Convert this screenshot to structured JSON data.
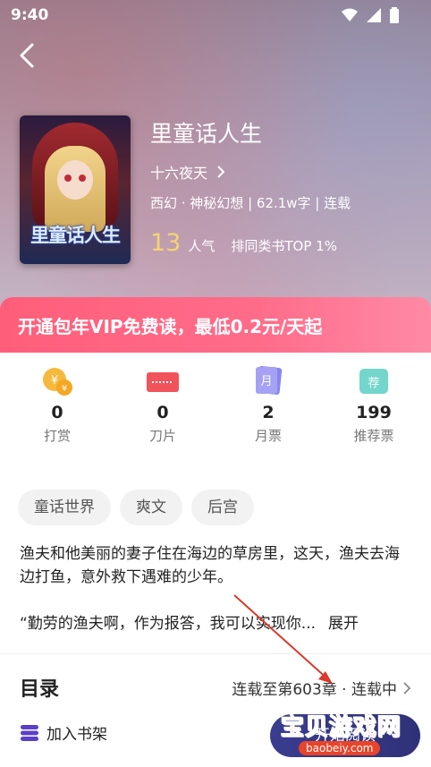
{
  "status": {
    "time": "9:40"
  },
  "book": {
    "cover_title": "里童话人生",
    "title": "里童话人生",
    "author": "十六夜天",
    "meta": "西幻 · 神秘幻想 | 62.1w字 | 连载",
    "popularity": "13",
    "popularity_label": "人气",
    "rank": "排同类书TOP 1%"
  },
  "vip": {
    "text": "开通包年VIP免费读，最低0.2元/天起"
  },
  "stats": [
    {
      "icon": "coin-icon",
      "value": "0",
      "label": "打赏"
    },
    {
      "icon": "blade-icon",
      "value": "0",
      "label": "刀片"
    },
    {
      "icon": "monthly-ticket-icon",
      "icon_text": "月",
      "value": "2",
      "label": "月票"
    },
    {
      "icon": "recommend-ticket-icon",
      "icon_text": "荐",
      "value": "199",
      "label": "推荐票"
    }
  ],
  "tags": [
    "童话世界",
    "爽文",
    "后宫"
  ],
  "description": {
    "para1": "渔夫和他美丽的妻子住在海边的草房里，这天，渔夫去海边打鱼，意外救下遇难的少年。",
    "para2": "“勤劳的渔夫啊，作为报答，我可以实现你...",
    "expand": "展开"
  },
  "toc": {
    "title": "目录",
    "status": "连载至第603章 · 连载中"
  },
  "bottom": {
    "shelf": "加入书架",
    "read": "开始阅读"
  },
  "watermark": {
    "brand": "宝贝游戏网",
    "url": "baobeiy.com"
  },
  "colors": {
    "vip_gradient_start": "#ff5e7a",
    "read_button": "#3a3d8f",
    "popularity": "#f2d572"
  }
}
